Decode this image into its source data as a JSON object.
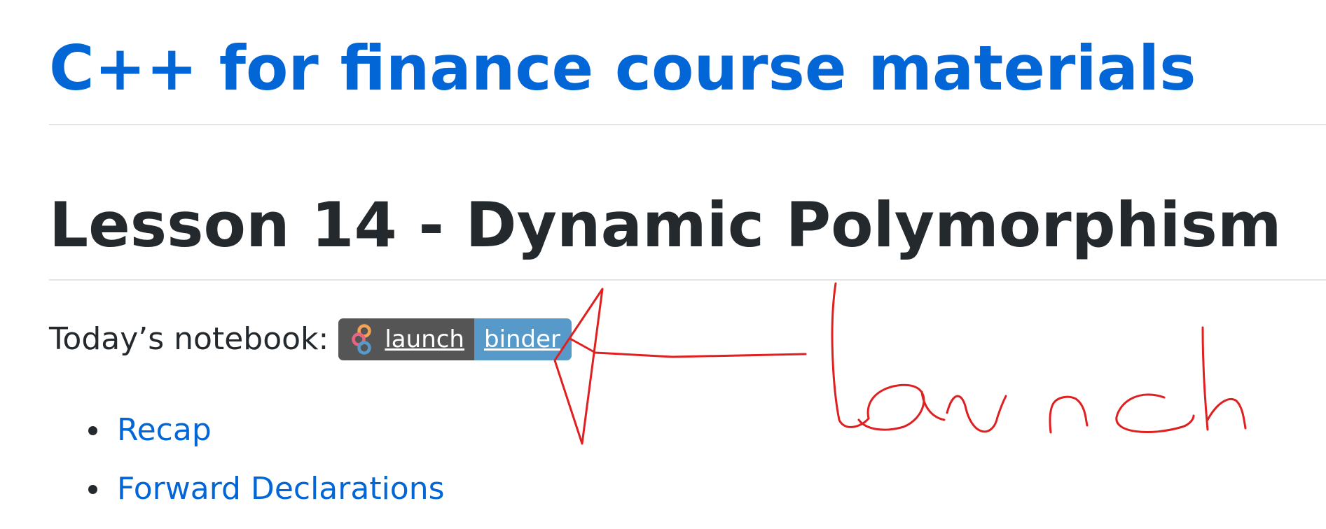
{
  "header": {
    "site_title": "C++ for finance course materials"
  },
  "main": {
    "lesson_title": "Lesson 14 - Dynamic Polymorphism",
    "notebook_label": "Today’s notebook:",
    "badge": {
      "left_text": "launch",
      "right_text": "binder",
      "left_color": "#555555",
      "right_color": "#579aca",
      "icon": "binder-logo-icon"
    },
    "toc": [
      {
        "label": "Recap"
      },
      {
        "label": "Forward Declarations"
      }
    ]
  },
  "annotation": {
    "handwritten_text": "launch",
    "stroke_color": "#e02020",
    "arrow_icon": "hand-drawn-arrow-icon"
  },
  "colors": {
    "link": "#0366d6",
    "heading": "#24292e",
    "rule": "#e1e4e8"
  }
}
